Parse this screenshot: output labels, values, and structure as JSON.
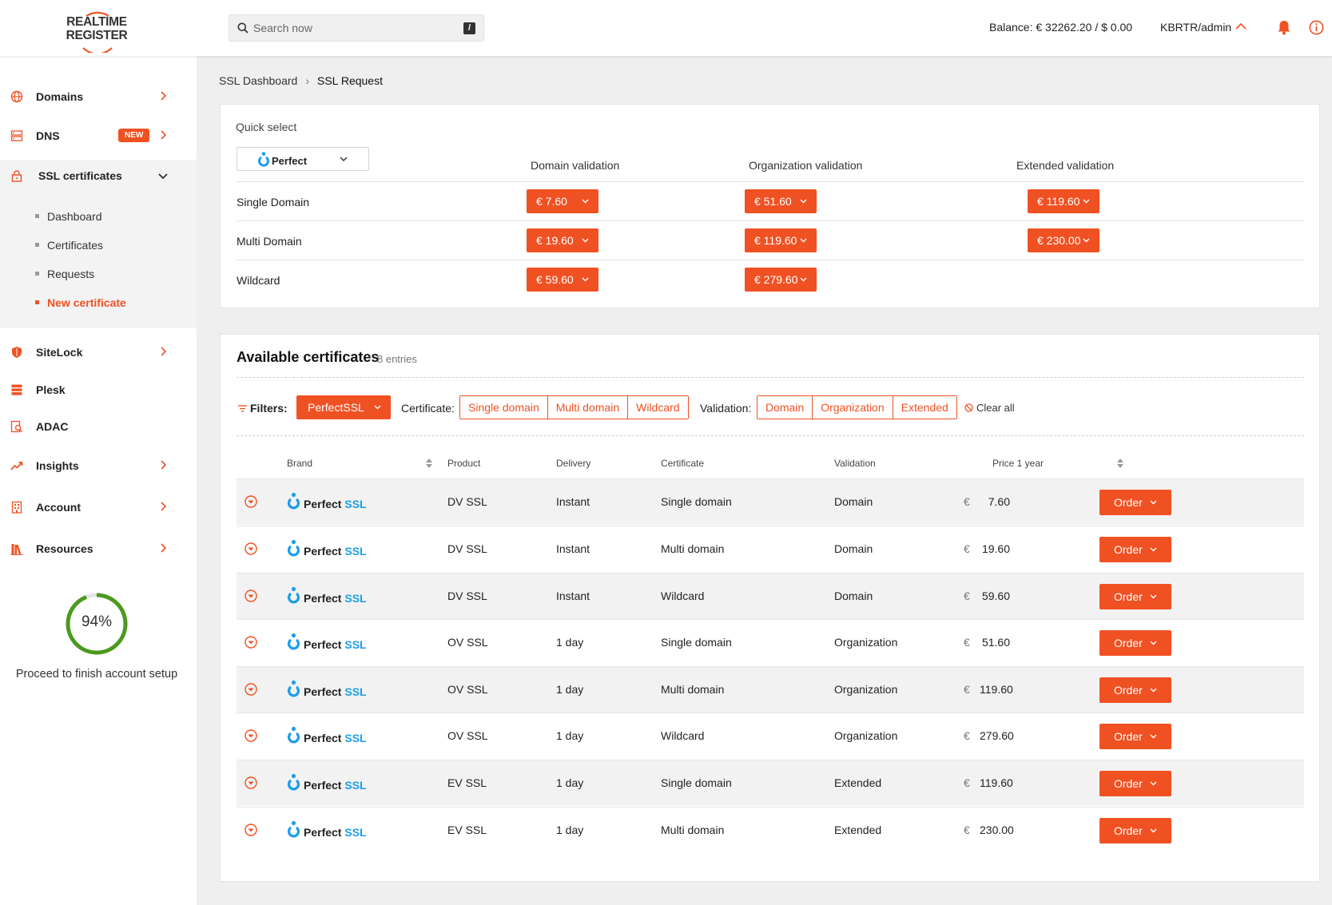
{
  "header": {
    "logo_line1": "REALTIME",
    "logo_line2": "REGISTER",
    "search_placeholder": "Search now",
    "search_shortcut": "/",
    "balance": "Balance: € 32262.20 / $ 0.00",
    "user": "KBRTR/admin"
  },
  "sidebar": {
    "items": [
      {
        "label": "Domains",
        "icon": "globe-icon"
      },
      {
        "label": "DNS",
        "icon": "server-icon",
        "badge": "NEW"
      },
      {
        "label": "SSL certificates",
        "icon": "lock-icon"
      },
      {
        "label": "SiteLock",
        "icon": "shield-icon"
      },
      {
        "label": "Plesk",
        "icon": "stack-icon"
      },
      {
        "label": "ADAC",
        "icon": "search-doc-icon"
      },
      {
        "label": "Insights",
        "icon": "trend-icon"
      },
      {
        "label": "Account",
        "icon": "building-icon"
      },
      {
        "label": "Resources",
        "icon": "books-icon"
      }
    ],
    "ssl_subitems": [
      "Dashboard",
      "Certificates",
      "Requests",
      "New certificate"
    ],
    "progress_percent": 94,
    "progress_label": "94%",
    "setup_text": "Proceed to finish account setup"
  },
  "breadcrumb": {
    "parent": "SSL Dashboard",
    "current": "SSL Request"
  },
  "quick_select": {
    "title": "Quick select",
    "brand": "PerfectSSL",
    "columns": [
      "Domain validation",
      "Organization validation",
      "Extended validation"
    ],
    "rows": [
      {
        "label": "Single Domain",
        "prices": [
          "€ 7.60",
          "€ 51.60",
          "€ 119.60"
        ]
      },
      {
        "label": "Multi Domain",
        "prices": [
          "€ 19.60",
          "€ 119.60",
          "€ 230.00"
        ]
      },
      {
        "label": "Wildcard",
        "prices": [
          "€ 59.60",
          "€ 279.60",
          null
        ]
      }
    ]
  },
  "available": {
    "title": "Available certificates",
    "count": "8 entries",
    "filters_label": "Filters:",
    "brand_filter": "PerfectSSL",
    "certificate_label": "Certificate:",
    "certificate_options": [
      "Single domain",
      "Multi domain",
      "Wildcard"
    ],
    "validation_label": "Validation:",
    "validation_options": [
      "Domain",
      "Organization",
      "Extended"
    ],
    "clear_all": "Clear all",
    "columns": [
      "Brand",
      "Product",
      "Delivery",
      "Certificate",
      "Validation",
      "Price 1 year"
    ],
    "currency": "€",
    "order_label": "Order",
    "brand_logo_text": "PerfectSSL",
    "rows": [
      {
        "product": "DV SSL",
        "delivery": "Instant",
        "certificate": "Single domain",
        "validation": "Domain",
        "price": "7.60"
      },
      {
        "product": "DV SSL",
        "delivery": "Instant",
        "certificate": "Multi domain",
        "validation": "Domain",
        "price": "19.60"
      },
      {
        "product": "DV SSL",
        "delivery": "Instant",
        "certificate": "Wildcard",
        "validation": "Domain",
        "price": "59.60"
      },
      {
        "product": "OV SSL",
        "delivery": "1 day",
        "certificate": "Single domain",
        "validation": "Organization",
        "price": "51.60"
      },
      {
        "product": "OV SSL",
        "delivery": "1 day",
        "certificate": "Multi domain",
        "validation": "Organization",
        "price": "119.60"
      },
      {
        "product": "OV SSL",
        "delivery": "1 day",
        "certificate": "Wildcard",
        "validation": "Organization",
        "price": "279.60"
      },
      {
        "product": "EV SSL",
        "delivery": "1 day",
        "certificate": "Single domain",
        "validation": "Extended",
        "price": "119.60"
      },
      {
        "product": "EV SSL",
        "delivery": "1 day",
        "certificate": "Multi domain",
        "validation": "Extended",
        "price": "230.00"
      }
    ]
  },
  "colors": {
    "accent": "#f05123",
    "progress": "#4a9a1c",
    "logo_blue": "#1e9ee8"
  }
}
